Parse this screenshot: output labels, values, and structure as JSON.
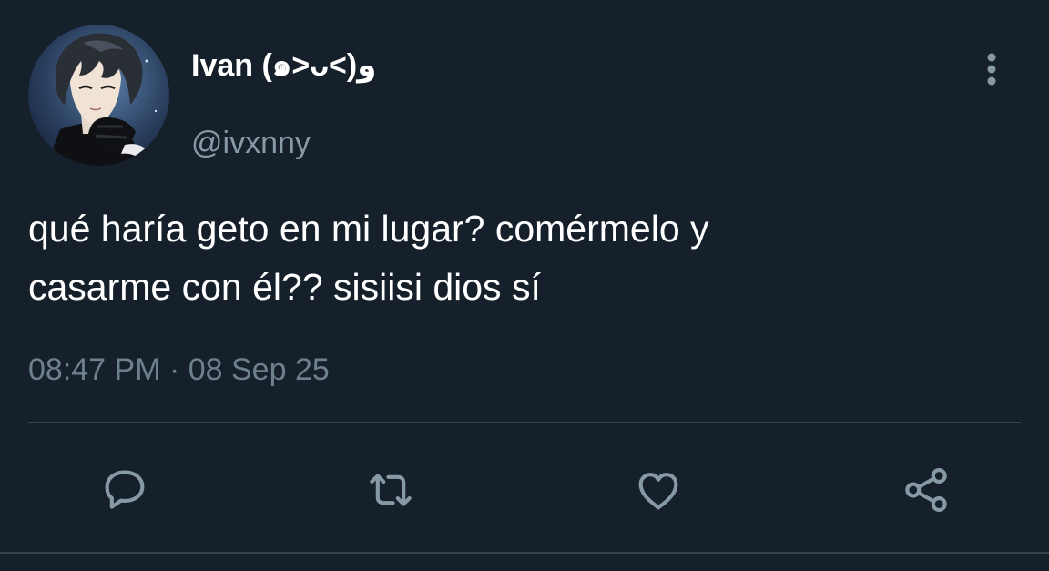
{
  "tweet": {
    "author": {
      "display_name": "Ivan (๑>ᴗ<)و",
      "handle": "@ivxnny",
      "avatar_icon": "anime-character-avatar"
    },
    "text": "qué haría geto en mi lugar? comérmelo y\ncasarme con él?? sisiisi dios sí",
    "timestamp": "08:47 PM · 08 Sep 25"
  },
  "actions": [
    {
      "icon": "reply-icon"
    },
    {
      "icon": "retweet-icon"
    },
    {
      "icon": "like-icon"
    },
    {
      "icon": "share-icon"
    }
  ],
  "menu": {
    "icon": "more-vertical-icon"
  },
  "colors": {
    "background": "#15202b",
    "primary_text": "#ffffff",
    "secondary_text": "#8899a6",
    "icon": "#8899a6",
    "divider": "#38444d"
  }
}
